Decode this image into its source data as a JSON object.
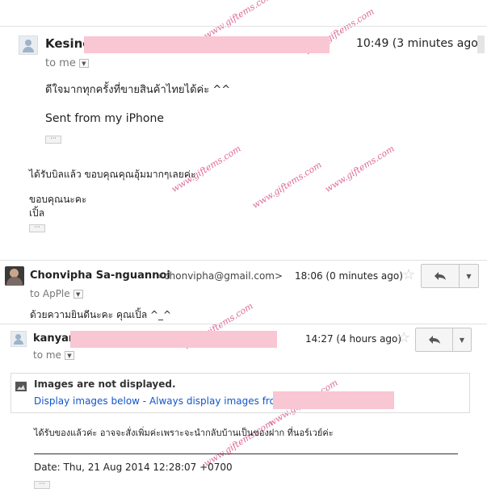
{
  "msg1": {
    "sender": "Kesine",
    "time": "10:49 (3 minutes ago)",
    "to_label": "to me",
    "body_line1": "ดีใจมากทุกครั้งที่ขายสินค้าไทยได้ค่ะ ^^",
    "body_line2": "Sent from my iPhone"
  },
  "reply_block": {
    "line1": "ได้รับบิลแล้ว ขอบคุณคุณอุ้มมากๆเลยค่ะ",
    "line2": "ขอบคุณนะคะ",
    "line3": "เปิ้ล"
  },
  "msg2": {
    "sender": "Chonvipha Sa-nguannoi",
    "email": "<chonvipha@gmail.com>",
    "time": "18:06 (0 minutes ago)",
    "to_label": "to ApPle",
    "body": "ด้วยความยินดีนะคะ คุณเปิ้ล ^_^"
  },
  "msg3": {
    "sender": "kanyan",
    "time": "14:27 (4 hours ago)",
    "to_label": "to me",
    "images_title": "Images are not displayed.",
    "display_below": "Display images below",
    "separator": " - ",
    "always_display": "Always display images from",
    "body": "ได้รับของแล้วค่ะ อาจจะสั่งเพิ่มค่ะเพราะจะนำกลับบ้านเป็นของฝาก ที่นอร์เวย์ค่ะ",
    "date_line": "Date: Thu, 21 Aug 2014 12:28:07 +0700"
  },
  "watermark_text": "www.giftems.com",
  "icons": {
    "avatar": "person-icon",
    "star": "star-icon",
    "reply": "reply-arrow-icon",
    "more": "chevron-down-icon",
    "image": "image-icon",
    "ellipsis": "ellipsis-icon"
  },
  "colors": {
    "redaction": "#f9c6d3",
    "link": "#1155cc",
    "watermark": "#d94f86"
  }
}
